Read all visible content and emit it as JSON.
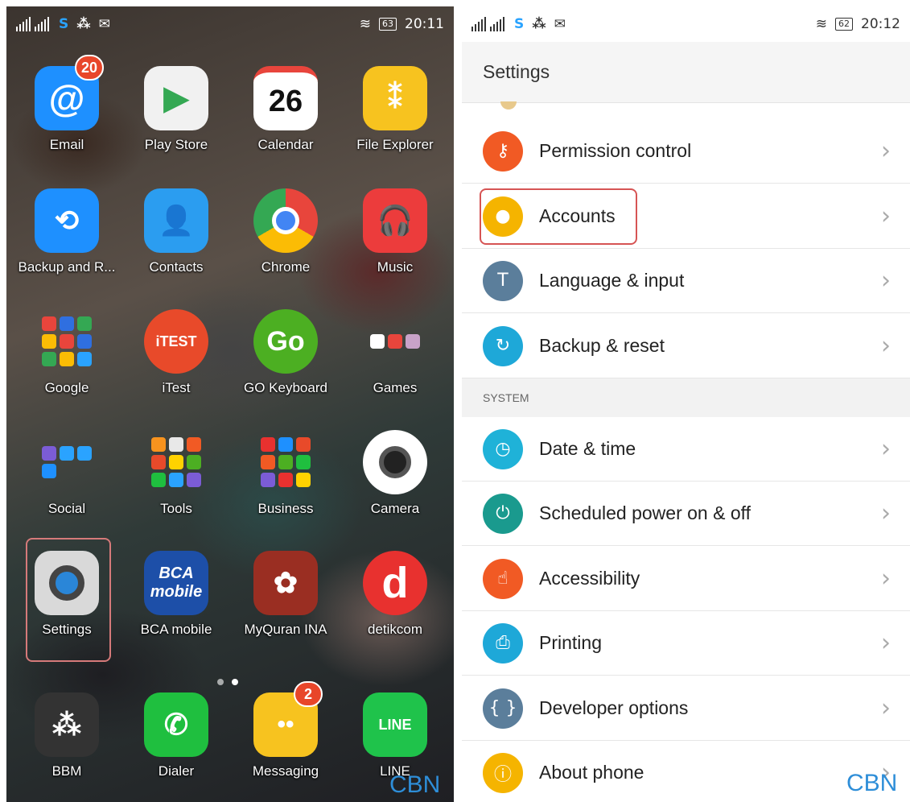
{
  "home": {
    "status": {
      "battery": "63",
      "time": "20:11"
    },
    "apps": [
      {
        "id": "email",
        "label": "Email",
        "badge": "20",
        "color": "#1e90ff",
        "icon": "at-icon",
        "glyph": "@"
      },
      {
        "id": "play-store",
        "label": "Play Store",
        "color": "#f1f1f1",
        "icon": "play-store-icon",
        "glyph": "▶"
      },
      {
        "id": "calendar",
        "label": "Calendar",
        "color": "#ffffff",
        "icon": "calendar-icon",
        "glyph": "26"
      },
      {
        "id": "file-explorer",
        "label": "File Explorer",
        "color": "#f7c31f",
        "icon": "folder-icon",
        "glyph": "⁑"
      },
      {
        "id": "backup",
        "label": "Backup and R...",
        "color": "#1e90ff",
        "icon": "backup-icon",
        "glyph": "⟲"
      },
      {
        "id": "contacts",
        "label": "Contacts",
        "color": "#2b9df0",
        "icon": "person-icon",
        "glyph": "👤"
      },
      {
        "id": "chrome",
        "label": "Chrome",
        "color": "#ffffff",
        "icon": "chrome-icon",
        "glyph": ""
      },
      {
        "id": "music",
        "label": "Music",
        "color": "#ec3c3c",
        "icon": "headphones-icon",
        "glyph": "🎧"
      },
      {
        "id": "google",
        "label": "Google",
        "icon": "folder-icon",
        "folder": true
      },
      {
        "id": "itest",
        "label": "iTest",
        "color": "#e84a2a",
        "icon": "itest-icon",
        "glyph": "iTEST"
      },
      {
        "id": "go-keyboard",
        "label": "GO Keyboard",
        "color": "#4caf22",
        "icon": "go-keyboard-icon",
        "glyph": "Go"
      },
      {
        "id": "games",
        "label": "Games",
        "icon": "folder-icon",
        "folder": true
      },
      {
        "id": "social",
        "label": "Social",
        "icon": "folder-icon",
        "folder": true
      },
      {
        "id": "tools",
        "label": "Tools",
        "icon": "folder-icon",
        "folder": true
      },
      {
        "id": "business",
        "label": "Business",
        "icon": "folder-icon",
        "folder": true
      },
      {
        "id": "camera",
        "label": "Camera",
        "color": "#ffffff",
        "icon": "camera-icon",
        "glyph": ""
      },
      {
        "id": "settings",
        "label": "Settings",
        "color": "#d9d9d9",
        "icon": "gear-icon",
        "glyph": ""
      },
      {
        "id": "bca",
        "label": "BCA mobile",
        "color": "#1d4fa8",
        "icon": "bca-icon",
        "glyph": "BCA mobile"
      },
      {
        "id": "myquran",
        "label": "MyQuran INA",
        "color": "#9a2e22",
        "icon": "quran-icon",
        "glyph": "✿"
      },
      {
        "id": "detik",
        "label": "detikcom",
        "color": "#e8312f",
        "icon": "detik-icon",
        "glyph": "d"
      },
      {
        "id": "bbm",
        "label": "BBM",
        "color": "#333333",
        "icon": "bbm-icon",
        "glyph": "⁂"
      },
      {
        "id": "dialer",
        "label": "Dialer",
        "color": "#1fbf3f",
        "icon": "phone-icon",
        "glyph": "✆"
      },
      {
        "id": "messaging",
        "label": "Messaging",
        "badge": "2",
        "color": "#f7c31f",
        "icon": "message-icon",
        "glyph": "••"
      },
      {
        "id": "line",
        "label": "LINE",
        "color": "#1fc34b",
        "icon": "line-icon",
        "glyph": "LINE"
      }
    ],
    "watermark": "CBN"
  },
  "settings": {
    "status": {
      "battery": "62",
      "time": "20:12"
    },
    "title": "Settings",
    "items": [
      {
        "label": "Permission control",
        "color": "#f15a24",
        "icon": "key-icon",
        "glyph": "⚷"
      },
      {
        "label": "Accounts",
        "color": "#f5b400",
        "icon": "account-icon",
        "glyph": "●"
      },
      {
        "label": "Language & input",
        "color": "#5b7e9b",
        "icon": "language-icon",
        "glyph": "T"
      },
      {
        "label": "Backup & reset",
        "color": "#1ea8d8",
        "icon": "reset-icon",
        "glyph": "↻"
      }
    ],
    "section": "SYSTEM",
    "system_items": [
      {
        "label": "Date & time",
        "color": "#1fb2d8",
        "icon": "clock-icon",
        "glyph": "◷"
      },
      {
        "label": "Scheduled power on & off",
        "color": "#1a9a8e",
        "icon": "power-schedule-icon",
        "glyph": "⏻"
      },
      {
        "label": "Accessibility",
        "color": "#f15a24",
        "icon": "hand-icon",
        "glyph": "☝"
      },
      {
        "label": "Printing",
        "color": "#1ea8d8",
        "icon": "printer-icon",
        "glyph": "⎙"
      },
      {
        "label": "Developer options",
        "color": "#5b7e9b",
        "icon": "code-icon",
        "glyph": "{ }"
      },
      {
        "label": "About phone",
        "color": "#f5b400",
        "icon": "info-icon",
        "glyph": "ⓘ"
      }
    ],
    "chevron": "›",
    "watermark": "CBN"
  }
}
